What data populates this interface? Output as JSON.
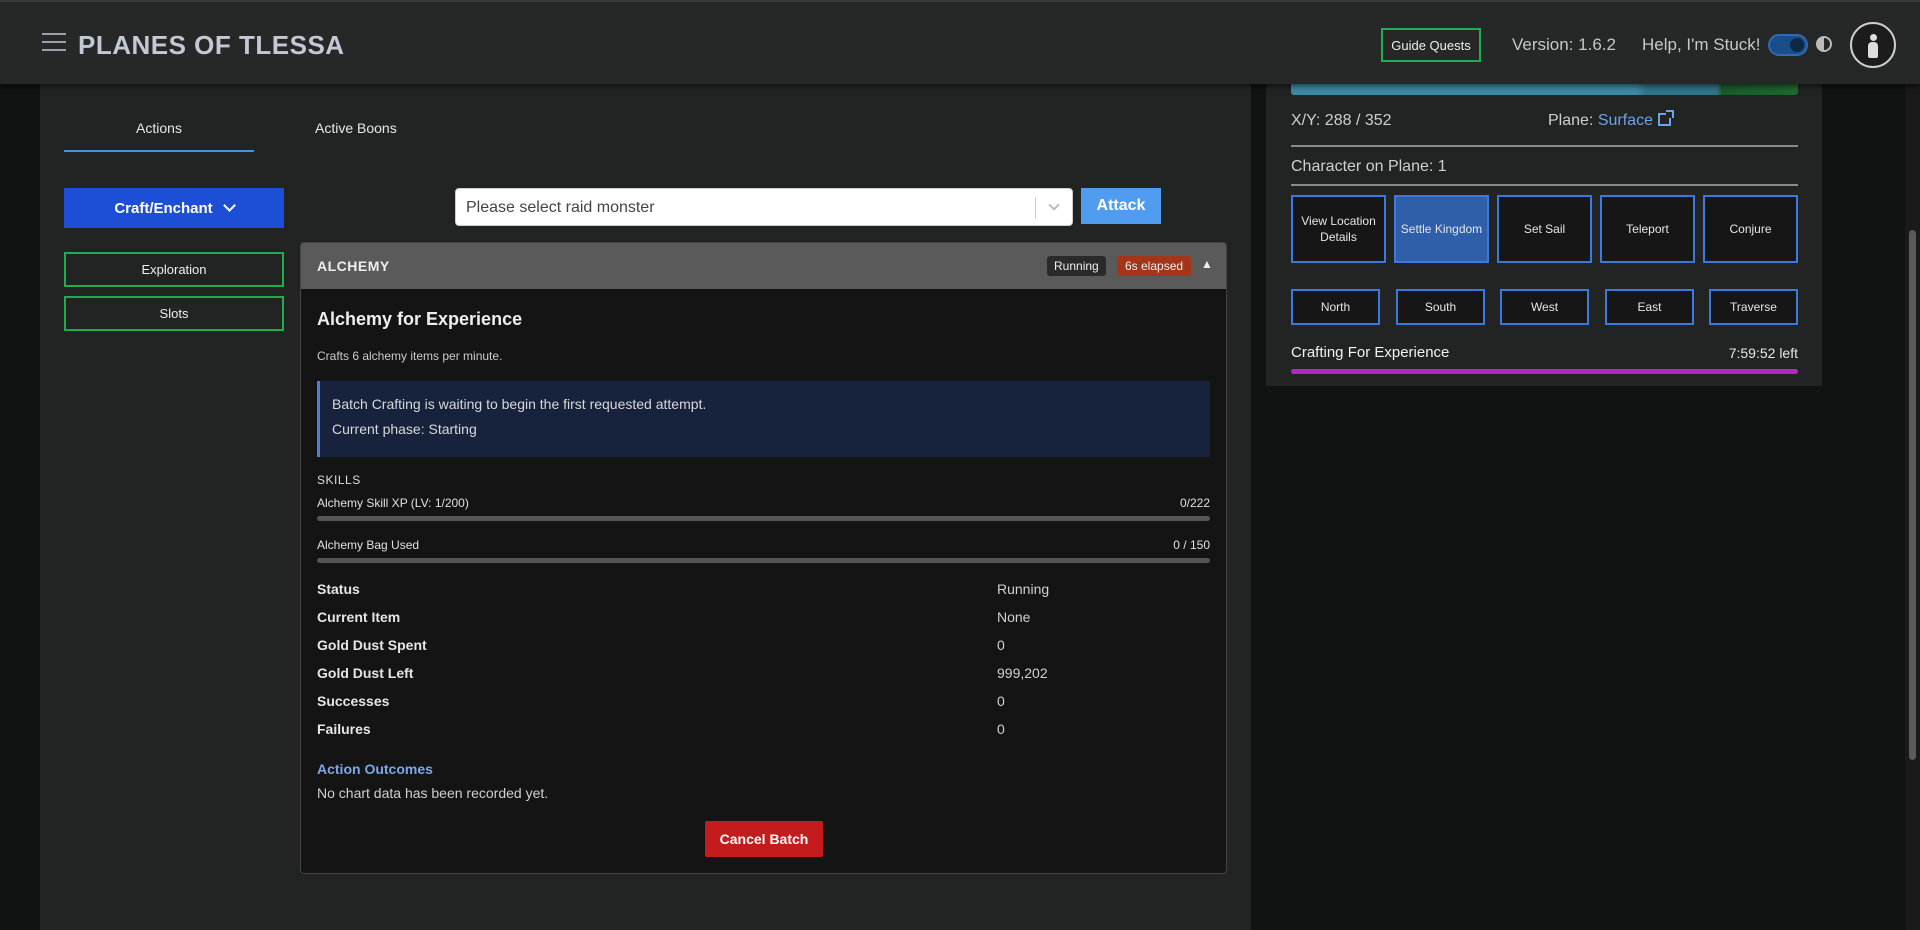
{
  "header": {
    "title": "PLANES OF TLESSA",
    "guide_quests": "Guide Quests",
    "version": "Version: 1.6.2",
    "help": "Help, I'm Stuck!"
  },
  "tabs": [
    {
      "label": "Actions",
      "active": true
    },
    {
      "label": "Active Boons",
      "active": false
    }
  ],
  "sidebar": {
    "craft_enchant": "Craft/Enchant",
    "exploration": "Exploration",
    "slots": "Slots"
  },
  "raid": {
    "placeholder": "Please select raid monster",
    "attack_label": "Attack"
  },
  "alchemy": {
    "header": "ALCHEMY",
    "status_badge": "Running",
    "elapsed_badge": "6s elapsed",
    "collapse": "▲",
    "title": "Alchemy for Experience",
    "subtitle": "Crafts 6 alchemy items per minute.",
    "info_line1": "Batch Crafting is waiting to begin the first requested attempt.",
    "info_line2": "Current phase: Starting",
    "skills_heading": "SKILLS",
    "skills": [
      {
        "label": "Alchemy Skill XP (LV: 1/200)",
        "value": "0/222",
        "progress": 0
      },
      {
        "label": "Alchemy Bag Used",
        "value": "0 / 150",
        "progress": 0
      }
    ],
    "stats": [
      {
        "label": "Status",
        "value": "Running"
      },
      {
        "label": "Current Item",
        "value": "None"
      },
      {
        "label": "Gold Dust Spent",
        "value": "0"
      },
      {
        "label": "Gold Dust Left",
        "value": "999,202"
      },
      {
        "label": "Successes",
        "value": "0"
      },
      {
        "label": "Failures",
        "value": "0"
      }
    ],
    "outcomes_title": "Action Outcomes",
    "outcomes_text": "No chart data has been recorded yet.",
    "cancel_label": "Cancel Batch"
  },
  "map_panel": {
    "xy": "X/Y: 288 / 352",
    "plane_label": "Plane:",
    "plane_value": "Surface",
    "character_on_plane": "Character on Plane: 1",
    "actions": [
      {
        "label": "View Location Details",
        "active": false
      },
      {
        "label": "Settle Kingdom",
        "active": true
      },
      {
        "label": "Set Sail",
        "active": false
      },
      {
        "label": "Teleport",
        "active": false
      },
      {
        "label": "Conjure",
        "active": false
      }
    ],
    "directions": [
      "North",
      "South",
      "West",
      "East",
      "Traverse"
    ],
    "crafting_label": "Crafting For Experience",
    "crafting_time_left": "7:59:52 left",
    "crafting_progress": 1.0
  },
  "colors": {
    "accent_blue": "#1d4fd6",
    "attack_blue": "#4f9cf0",
    "cancel_red": "#c41c1c",
    "elapsed_orange": "#a3361a",
    "progress_magenta": "#b425c4",
    "outline_green": "#1fae4e"
  },
  "icons": [
    "hamburger-icon",
    "chevron-down-icon",
    "external-link-icon",
    "contrast-icon",
    "user-icon",
    "caret-down-icon"
  ]
}
